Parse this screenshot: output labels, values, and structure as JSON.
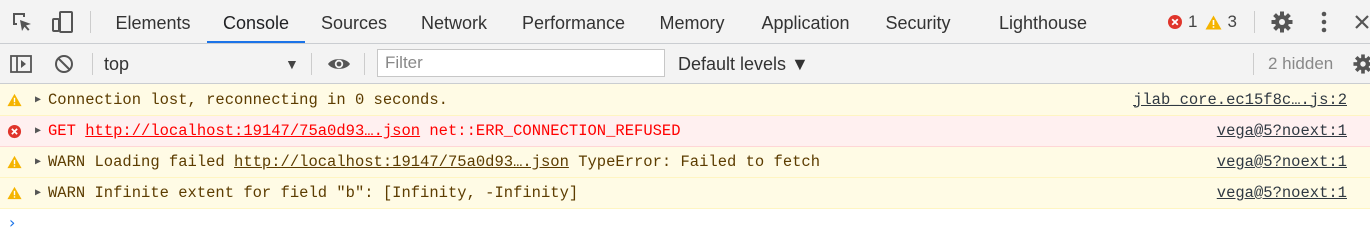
{
  "tabs": [
    {
      "label": "Elements"
    },
    {
      "label": "Console",
      "active": true
    },
    {
      "label": "Sources"
    },
    {
      "label": "Network"
    },
    {
      "label": "Performance"
    },
    {
      "label": "Memory"
    },
    {
      "label": "Application"
    },
    {
      "label": "Security"
    },
    {
      "label": "Lighthouse"
    }
  ],
  "counts": {
    "errors": "1",
    "warnings": "3"
  },
  "toolbar": {
    "context": "top",
    "filter_placeholder": "Filter",
    "levels": "Default levels ▼",
    "hidden": "2 hidden"
  },
  "messages": [
    {
      "level": "warning",
      "text": "Connection lost, reconnecting in 0 seconds.",
      "source": "jlab_core.ec15f8c….js:2"
    },
    {
      "level": "error",
      "prefix": "GET ",
      "link": "http://localhost:19147/75a0d93….json",
      "suffix": " net::ERR_CONNECTION_REFUSED",
      "source": "vega@5?noext:1"
    },
    {
      "level": "warning",
      "prefix": "WARN Loading failed ",
      "link": "http://localhost:19147/75a0d93….json",
      "suffix": " TypeError: Failed to fetch",
      "source": "vega@5?noext:1"
    },
    {
      "level": "warning",
      "text": "WARN Infinite extent for field \"b\": [Infinity, -Infinity]",
      "source": "vega@5?noext:1"
    }
  ],
  "icons": {
    "inspect": "inspect-element-icon",
    "device": "device-toolbar-icon",
    "error": "error-icon",
    "warning": "warning-icon",
    "settings": "gear-icon",
    "more": "kebab-menu-icon",
    "close": "close-icon",
    "sidebar": "show-sidebar-icon",
    "clear": "clear-console-icon",
    "eye": "live-expression-icon",
    "prompt": "console-prompt-icon"
  },
  "colors": {
    "accent": "#1a73e8",
    "error": "#ff0000",
    "warning": "#f5b400"
  }
}
